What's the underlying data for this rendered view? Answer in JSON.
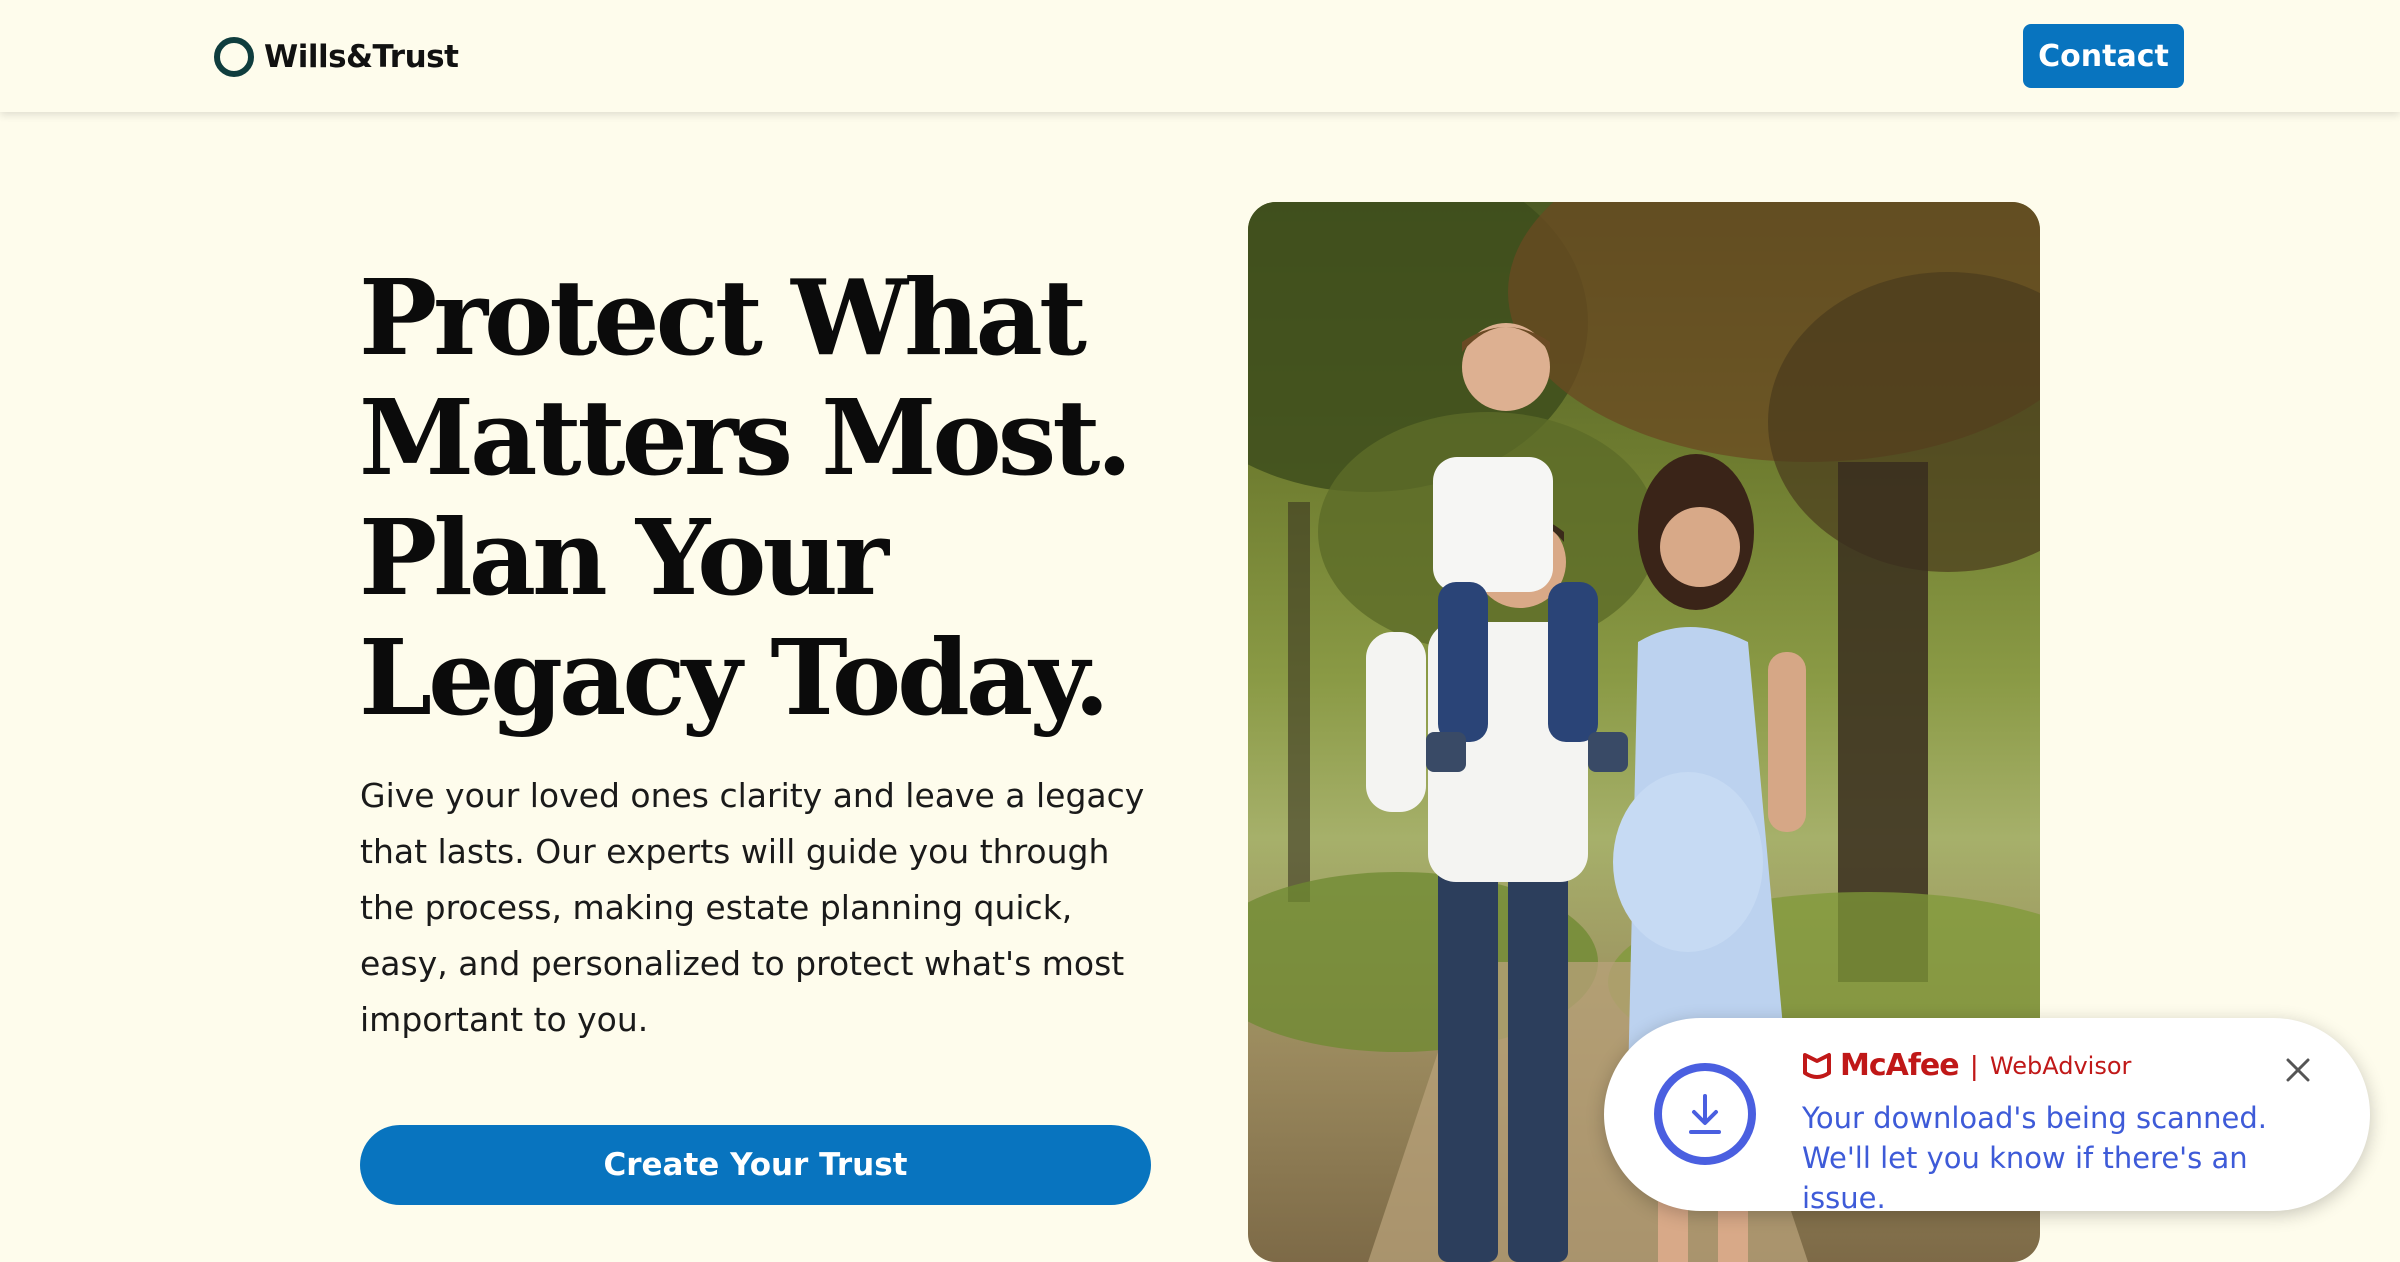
{
  "header": {
    "logo_text": "Wills&Trust",
    "contact_label": "Contact"
  },
  "hero": {
    "title": "Protect What Matters Most. Plan Your Legacy Today.",
    "subtitle": "Give your loved ones clarity and leave a legacy that lasts. Our experts will guide you through the process, making estate planning quick, easy, and personalized to protect what's most important to you.",
    "cta_label": "Create Your Trust"
  },
  "toast": {
    "brand": "McAfee",
    "product": "WebAdvisor",
    "message": "Your download's being scanned. We'll let you know if there's an issue."
  },
  "colors": {
    "background": "#fefcec",
    "primary": "#0874bf",
    "mcafee_red": "#c01818",
    "toast_blue": "#3e5bd8"
  },
  "icons": [
    "logo-ring-icon",
    "download-icon",
    "mcafee-shield-icon",
    "close-icon"
  ]
}
